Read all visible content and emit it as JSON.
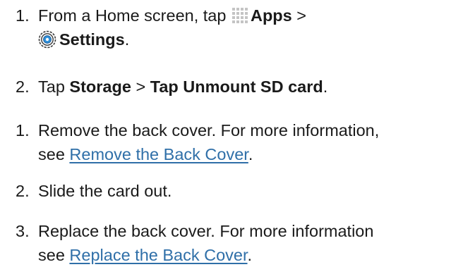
{
  "steps": [
    {
      "number": "1.",
      "part1": "From a Home screen, tap ",
      "apps_label": "Apps",
      "sep": " >",
      "settings_label": "Settings",
      "end": "."
    },
    {
      "number": "2.",
      "part1": "Tap ",
      "storage_label": "Storage",
      "sep": " > ",
      "unmount_label": "Tap Unmount SD card",
      "end": "."
    },
    {
      "number": "1.",
      "line1": "Remove the back cover. For more information,",
      "line2_prefix": "see ",
      "link": "Remove the Back Cover",
      "end": "."
    },
    {
      "number": "2.",
      "text": "Slide the card out."
    },
    {
      "number": "3.",
      "line1": "Replace the back cover. For more information",
      "line2_prefix": "see ",
      "link": "Replace the Back Cover",
      "end": "."
    }
  ],
  "icons": {
    "apps": "apps-grid-icon",
    "settings": "settings-gear-icon"
  }
}
